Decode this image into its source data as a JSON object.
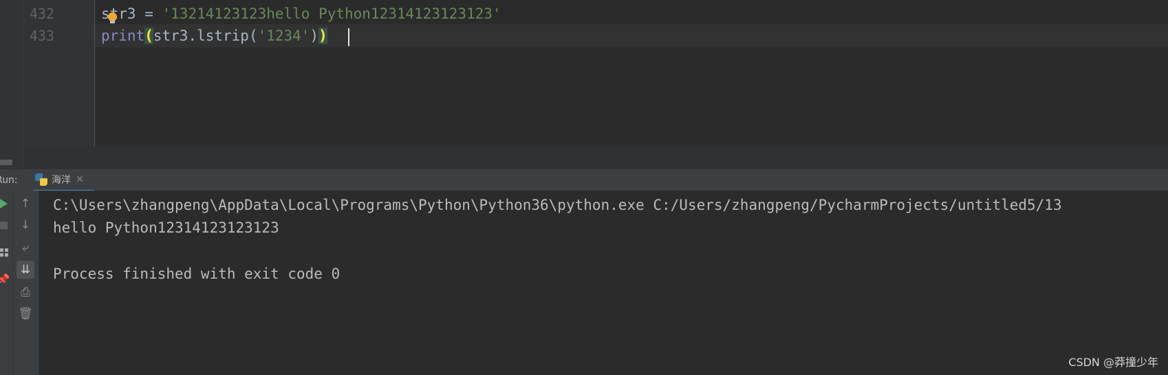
{
  "editor": {
    "lines": [
      {
        "number": "432",
        "tokens": {
          "a": "str3 = ",
          "b": "'13214123123hello Python12314123123123'"
        }
      },
      {
        "number": "433",
        "tokens": {
          "func": "print",
          "open": "(",
          "mid": "str3.lstrip(",
          "arg": "'1234'",
          "mid2": ")",
          "close": ")"
        }
      }
    ],
    "icons": {
      "intention": "lightbulb-icon"
    }
  },
  "run": {
    "label": "Run:",
    "tab": {
      "title": "海洋",
      "close": "✕",
      "icon": "python-icon"
    },
    "toolbar": {
      "rerun_icon": "play-icon",
      "stop_icon": "stop-icon",
      "layout_icon": "layout-icon",
      "pin_icon": "pin-icon",
      "up_icon": "↑",
      "down_icon": "↓",
      "wrap_icon": "⤶",
      "scroll_icon": "⇊",
      "print_icon": "⎙",
      "trash_icon": "🗑"
    },
    "console": {
      "lines": [
        "C:\\Users\\zhangpeng\\AppData\\Local\\Programs\\Python\\Python36\\python.exe C:/Users/zhangpeng/PycharmProjects/untitled5/13",
        "hello Python12314123123123",
        "",
        "Process finished with exit code 0"
      ]
    }
  },
  "watermark": "CSDN @莽撞少年",
  "colors": {
    "string": "#6a8759",
    "builtin": "#8888c6",
    "default_text": "#a9b7c6",
    "background": "#2b2b2b",
    "accent": "#4a88c7"
  }
}
